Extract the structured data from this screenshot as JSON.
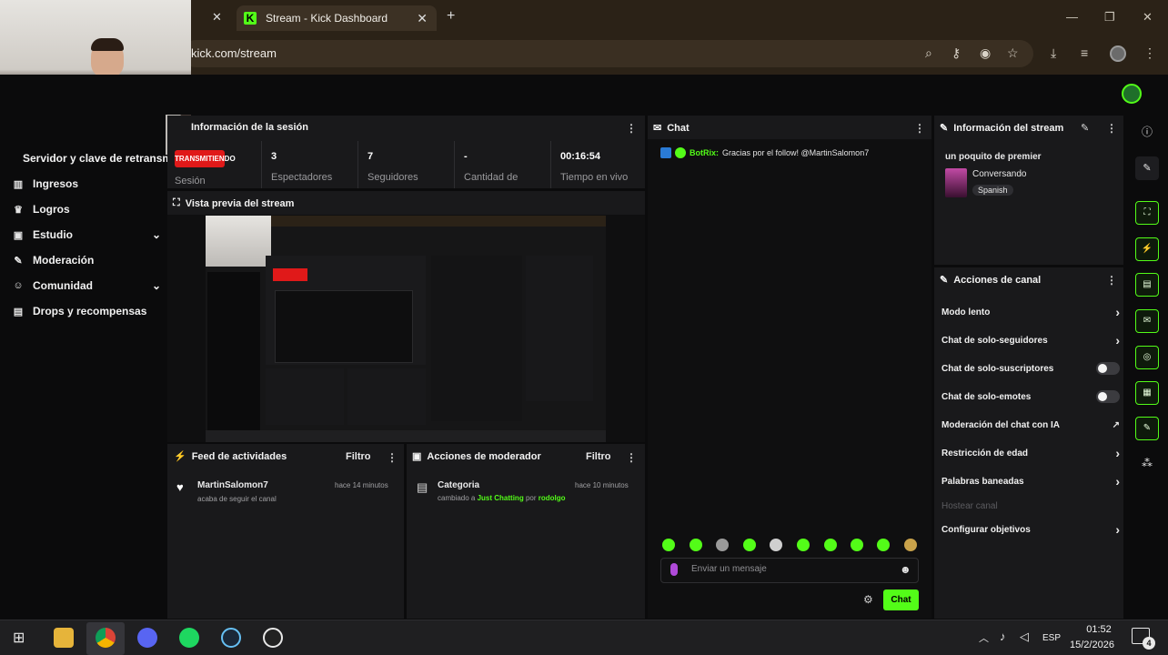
{
  "browser": {
    "tab_title": "Stream - Kick Dashboard",
    "tab_close": "✕",
    "prev_tab_close": "✕",
    "new_tab": "+",
    "url": "kick.com/stream"
  },
  "sidebar": {
    "server_label": "Servidor y clave de retransm",
    "items": [
      {
        "label": "Ingresos",
        "icon": "bar-chart-icon"
      },
      {
        "label": "Logros",
        "icon": "trophy-icon"
      },
      {
        "label": "Estudio",
        "icon": "studio-icon"
      },
      {
        "label": "Moderación",
        "icon": "wrench-icon"
      },
      {
        "label": "Comunidad",
        "icon": "community-icon"
      },
      {
        "label": "Drops y recompensas",
        "icon": "drops-icon"
      }
    ]
  },
  "session": {
    "title": "Información de la sesión",
    "badge": "TRANSMITIENDO",
    "badge_label": "Sesión",
    "stats": [
      {
        "value": "3",
        "label": "Espectadores"
      },
      {
        "value": "7",
        "label": "Seguidores"
      },
      {
        "value": "-",
        "label": "Cantidad de"
      },
      {
        "value": "00:16:54",
        "label": "Tiempo en vivo"
      }
    ]
  },
  "preview": {
    "title": "Vista previa del stream"
  },
  "activity": {
    "title": "Feed de actividades",
    "filter": "Filtro",
    "item_user": "MartinSalomon7",
    "item_time": "hace 14 minutos",
    "item_text": "acaba de seguir el canal"
  },
  "modactions": {
    "title": "Acciones de moderador",
    "filter": "Filtro",
    "item_title": "Categoria",
    "item_time": "hace 10 minutos",
    "item_pre": "cambiado a",
    "item_category": "Just Chatting",
    "item_mid": "por",
    "item_user": "rodolgo"
  },
  "chat": {
    "title": "Chat",
    "message_user": "BotRix:",
    "message_text": "Gracias por el follow! @MartinSalomon7",
    "input_placeholder": "Enviar un mensaje",
    "send_label": "Chat"
  },
  "stream_info": {
    "title": "Información del stream",
    "stream_title": "un poquito de premier",
    "category": "Conversando",
    "language": "Spanish"
  },
  "channel_actions": {
    "title": "Acciones de canal",
    "items": [
      {
        "label": "Modo lento",
        "control": "chevron"
      },
      {
        "label": "Chat de solo-seguidores",
        "control": "chevron"
      },
      {
        "label": "Chat de solo-suscriptores",
        "control": "toggle",
        "state": "off"
      },
      {
        "label": "Chat de solo-emotes",
        "control": "toggle",
        "state": "off"
      },
      {
        "label": "Moderación del chat con IA",
        "control": "chart"
      },
      {
        "label": "Restricción de edad",
        "control": "chevron"
      },
      {
        "label": "Palabras baneadas",
        "control": "chevron"
      },
      {
        "label": "Hostear canal",
        "control": "disabled"
      },
      {
        "label": "Configurar objetivos",
        "control": "chevron"
      }
    ]
  },
  "taskbar": {
    "lang": "ESP",
    "time": "01:52",
    "date": "15/2/2026",
    "notifications": "4"
  },
  "colors": {
    "accent": "#53fc18",
    "live": "#e01919",
    "panel": "#19191b",
    "background": "#0b0b0c"
  }
}
